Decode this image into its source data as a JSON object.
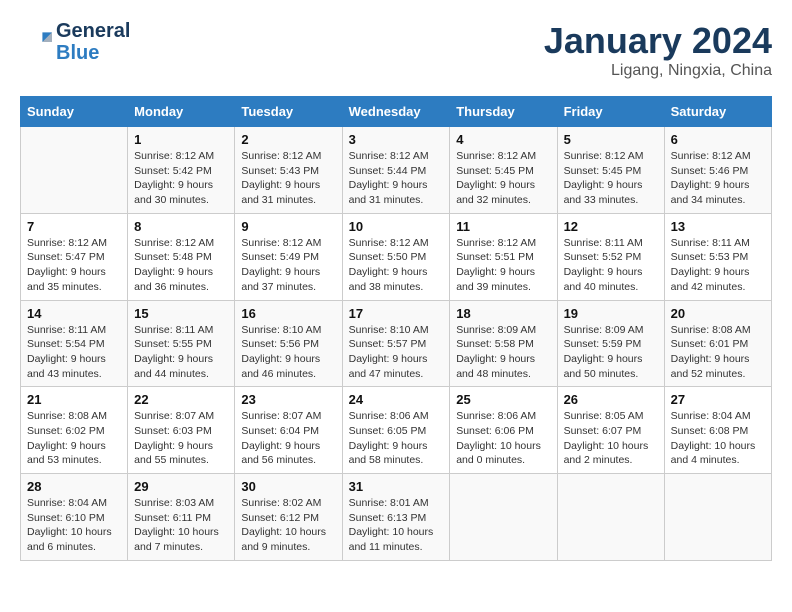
{
  "header": {
    "logo_line1": "General",
    "logo_line2": "Blue",
    "month": "January 2024",
    "location": "Ligang, Ningxia, China"
  },
  "days_of_week": [
    "Sunday",
    "Monday",
    "Tuesday",
    "Wednesday",
    "Thursday",
    "Friday",
    "Saturday"
  ],
  "weeks": [
    [
      {
        "day": "",
        "info": ""
      },
      {
        "day": "1",
        "info": "Sunrise: 8:12 AM\nSunset: 5:42 PM\nDaylight: 9 hours\nand 30 minutes."
      },
      {
        "day": "2",
        "info": "Sunrise: 8:12 AM\nSunset: 5:43 PM\nDaylight: 9 hours\nand 31 minutes."
      },
      {
        "day": "3",
        "info": "Sunrise: 8:12 AM\nSunset: 5:44 PM\nDaylight: 9 hours\nand 31 minutes."
      },
      {
        "day": "4",
        "info": "Sunrise: 8:12 AM\nSunset: 5:45 PM\nDaylight: 9 hours\nand 32 minutes."
      },
      {
        "day": "5",
        "info": "Sunrise: 8:12 AM\nSunset: 5:45 PM\nDaylight: 9 hours\nand 33 minutes."
      },
      {
        "day": "6",
        "info": "Sunrise: 8:12 AM\nSunset: 5:46 PM\nDaylight: 9 hours\nand 34 minutes."
      }
    ],
    [
      {
        "day": "7",
        "info": "Sunrise: 8:12 AM\nSunset: 5:47 PM\nDaylight: 9 hours\nand 35 minutes."
      },
      {
        "day": "8",
        "info": "Sunrise: 8:12 AM\nSunset: 5:48 PM\nDaylight: 9 hours\nand 36 minutes."
      },
      {
        "day": "9",
        "info": "Sunrise: 8:12 AM\nSunset: 5:49 PM\nDaylight: 9 hours\nand 37 minutes."
      },
      {
        "day": "10",
        "info": "Sunrise: 8:12 AM\nSunset: 5:50 PM\nDaylight: 9 hours\nand 38 minutes."
      },
      {
        "day": "11",
        "info": "Sunrise: 8:12 AM\nSunset: 5:51 PM\nDaylight: 9 hours\nand 39 minutes."
      },
      {
        "day": "12",
        "info": "Sunrise: 8:11 AM\nSunset: 5:52 PM\nDaylight: 9 hours\nand 40 minutes."
      },
      {
        "day": "13",
        "info": "Sunrise: 8:11 AM\nSunset: 5:53 PM\nDaylight: 9 hours\nand 42 minutes."
      }
    ],
    [
      {
        "day": "14",
        "info": "Sunrise: 8:11 AM\nSunset: 5:54 PM\nDaylight: 9 hours\nand 43 minutes."
      },
      {
        "day": "15",
        "info": "Sunrise: 8:11 AM\nSunset: 5:55 PM\nDaylight: 9 hours\nand 44 minutes."
      },
      {
        "day": "16",
        "info": "Sunrise: 8:10 AM\nSunset: 5:56 PM\nDaylight: 9 hours\nand 46 minutes."
      },
      {
        "day": "17",
        "info": "Sunrise: 8:10 AM\nSunset: 5:57 PM\nDaylight: 9 hours\nand 47 minutes."
      },
      {
        "day": "18",
        "info": "Sunrise: 8:09 AM\nSunset: 5:58 PM\nDaylight: 9 hours\nand 48 minutes."
      },
      {
        "day": "19",
        "info": "Sunrise: 8:09 AM\nSunset: 5:59 PM\nDaylight: 9 hours\nand 50 minutes."
      },
      {
        "day": "20",
        "info": "Sunrise: 8:08 AM\nSunset: 6:01 PM\nDaylight: 9 hours\nand 52 minutes."
      }
    ],
    [
      {
        "day": "21",
        "info": "Sunrise: 8:08 AM\nSunset: 6:02 PM\nDaylight: 9 hours\nand 53 minutes."
      },
      {
        "day": "22",
        "info": "Sunrise: 8:07 AM\nSunset: 6:03 PM\nDaylight: 9 hours\nand 55 minutes."
      },
      {
        "day": "23",
        "info": "Sunrise: 8:07 AM\nSunset: 6:04 PM\nDaylight: 9 hours\nand 56 minutes."
      },
      {
        "day": "24",
        "info": "Sunrise: 8:06 AM\nSunset: 6:05 PM\nDaylight: 9 hours\nand 58 minutes."
      },
      {
        "day": "25",
        "info": "Sunrise: 8:06 AM\nSunset: 6:06 PM\nDaylight: 10 hours\nand 0 minutes."
      },
      {
        "day": "26",
        "info": "Sunrise: 8:05 AM\nSunset: 6:07 PM\nDaylight: 10 hours\nand 2 minutes."
      },
      {
        "day": "27",
        "info": "Sunrise: 8:04 AM\nSunset: 6:08 PM\nDaylight: 10 hours\nand 4 minutes."
      }
    ],
    [
      {
        "day": "28",
        "info": "Sunrise: 8:04 AM\nSunset: 6:10 PM\nDaylight: 10 hours\nand 6 minutes."
      },
      {
        "day": "29",
        "info": "Sunrise: 8:03 AM\nSunset: 6:11 PM\nDaylight: 10 hours\nand 7 minutes."
      },
      {
        "day": "30",
        "info": "Sunrise: 8:02 AM\nSunset: 6:12 PM\nDaylight: 10 hours\nand 9 minutes."
      },
      {
        "day": "31",
        "info": "Sunrise: 8:01 AM\nSunset: 6:13 PM\nDaylight: 10 hours\nand 11 minutes."
      },
      {
        "day": "",
        "info": ""
      },
      {
        "day": "",
        "info": ""
      },
      {
        "day": "",
        "info": ""
      }
    ]
  ]
}
